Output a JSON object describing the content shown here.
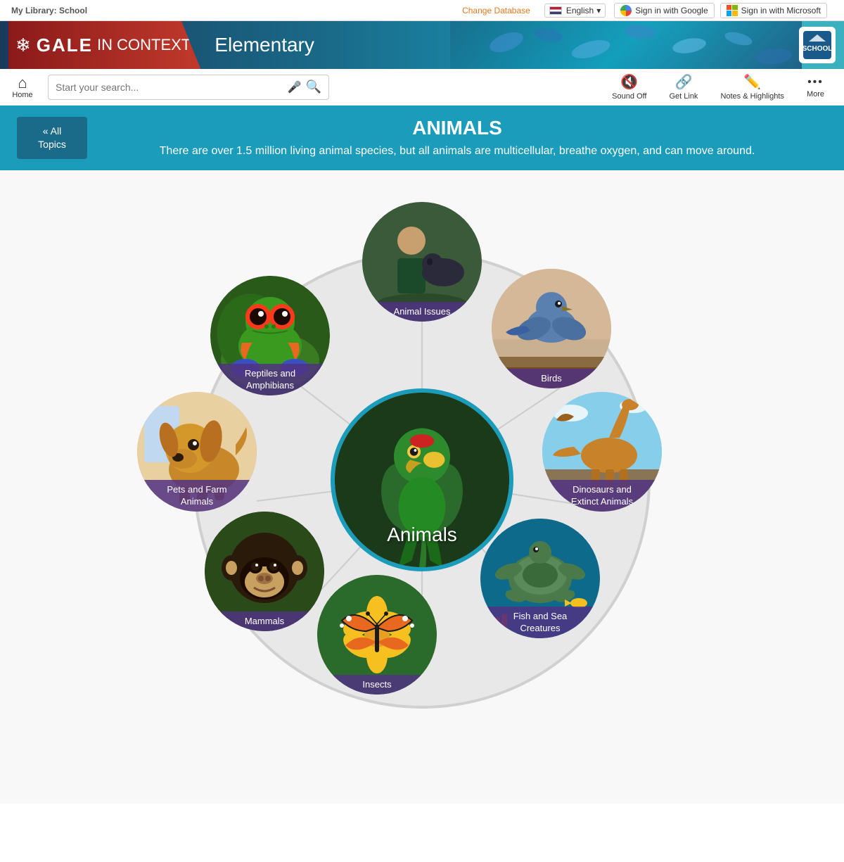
{
  "topBar": {
    "myLibrary": "My Library:",
    "libraryName": "School",
    "changeDb": "Change Database",
    "language": "English",
    "signInGoogle": "Sign in with Google",
    "signInMicrosoft": "Sign in with Microsoft"
  },
  "header": {
    "galeText": "GALE",
    "inContext": "IN CONTEXT",
    "elementary": "Elementary",
    "snowflake": "❄"
  },
  "searchBar": {
    "homeLabel": "Home",
    "placeholder": "Start your search...",
    "soundOff": "Sound Off",
    "getLink": "Get Link",
    "notesHighlights": "Notes & Highlights",
    "more": "More"
  },
  "topicHeader": {
    "allTopics": "«  All\nTopics",
    "title": "ANIMALS",
    "description": "There are over 1.5 million living animal species, but all animals are multicellular, breathe oxygen, and can move around."
  },
  "centerNode": {
    "label": "Animals"
  },
  "topicNodes": [
    {
      "id": "animal-issues",
      "label": "Animal Issues",
      "angle": -90
    },
    {
      "id": "birds",
      "label": "Birds",
      "angle": -30
    },
    {
      "id": "dinosaurs",
      "label": "Dinosaurs and\nExtinct Animals",
      "angle": 30
    },
    {
      "id": "fish",
      "label": "Fish and Sea\nCreatures",
      "angle": 90
    },
    {
      "id": "insects",
      "label": "Insects",
      "angle": 120
    },
    {
      "id": "mammals",
      "label": "Mammals",
      "angle": 150
    },
    {
      "id": "pets",
      "label": "Pets and Farm\nAnimals",
      "angle": 180
    },
    {
      "id": "reptiles",
      "label": "Reptiles and\nAmphibians",
      "angle": 225
    }
  ]
}
